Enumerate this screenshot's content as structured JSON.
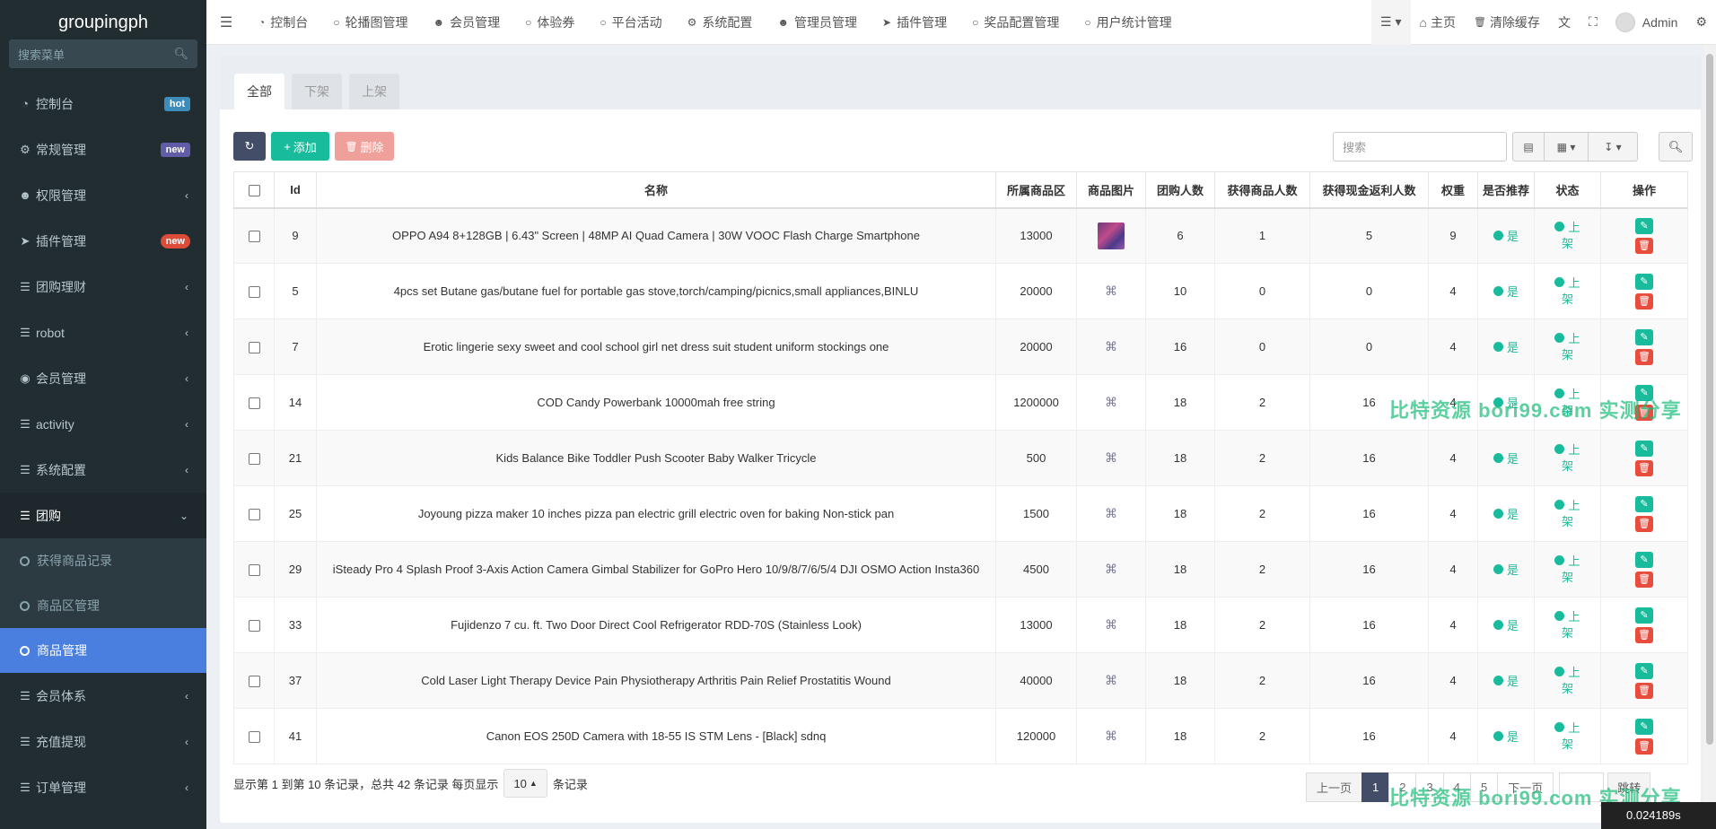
{
  "app": {
    "title": "groupingph"
  },
  "sidebar": {
    "search_placeholder": "搜索菜单",
    "items": [
      {
        "label": "控制台",
        "badge": "hot"
      },
      {
        "label": "常规管理",
        "badge": "new"
      },
      {
        "label": "权限管理"
      },
      {
        "label": "插件管理",
        "badge": "new"
      },
      {
        "label": "团购理财"
      },
      {
        "label": "robot"
      },
      {
        "label": "会员管理"
      },
      {
        "label": "activity"
      },
      {
        "label": "系统配置"
      },
      {
        "label": "团购"
      }
    ],
    "sub_items": [
      {
        "label": "获得商品记录"
      },
      {
        "label": "商品区管理"
      },
      {
        "label": "商品管理"
      }
    ],
    "items_after": [
      {
        "label": "会员体系"
      },
      {
        "label": "充值提现"
      },
      {
        "label": "订单管理"
      }
    ]
  },
  "topnav": {
    "items": [
      {
        "label": "控制台"
      },
      {
        "label": "轮播图管理"
      },
      {
        "label": "会员管理"
      },
      {
        "label": "体验券"
      },
      {
        "label": "平台活动"
      },
      {
        "label": "系统配置"
      },
      {
        "label": "管理员管理"
      },
      {
        "label": "插件管理"
      },
      {
        "label": "奖品配置管理"
      },
      {
        "label": "用户统计管理"
      }
    ],
    "home": "主页",
    "clear_cache": "清除缓存",
    "user": "Admin"
  },
  "tabs": [
    {
      "label": "全部"
    },
    {
      "label": "下架"
    },
    {
      "label": "上架"
    }
  ],
  "toolbar": {
    "add": "添加",
    "delete": "删除",
    "search_placeholder": "搜索"
  },
  "table": {
    "columns": [
      "Id",
      "名称",
      "所属商品区",
      "商品图片",
      "团购人数",
      "获得商品人数",
      "获得现金返利人数",
      "权重",
      "是否推荐",
      "状态",
      "操作"
    ],
    "recommend_text": "是",
    "status_text": "上架",
    "rows": [
      {
        "id": "9",
        "name": "OPPO A94 8+128GB | 6.43\" Screen | 48MP AI Quad Camera | 30W VOOC Flash Charge Smartphone",
        "zone": "13000",
        "group": "6",
        "win": "1",
        "cash": "5",
        "weight": "9"
      },
      {
        "id": "5",
        "name": "4pcs set Butane gas/butane fuel for portable gas stove,torch/camping/picnics,small appliances,BINLU",
        "zone": "20000",
        "group": "10",
        "win": "0",
        "cash": "0",
        "weight": "4"
      },
      {
        "id": "7",
        "name": "Erotic lingerie sexy sweet and cool school girl net dress suit student uniform stockings one",
        "zone": "20000",
        "group": "16",
        "win": "0",
        "cash": "0",
        "weight": "4"
      },
      {
        "id": "14",
        "name": "COD Candy Powerbank 10000mah free string",
        "zone": "1200000",
        "group": "18",
        "win": "2",
        "cash": "16",
        "weight": "4"
      },
      {
        "id": "21",
        "name": "Kids Balance Bike Toddler Push Scooter Baby Walker Tricycle",
        "zone": "500",
        "group": "18",
        "win": "2",
        "cash": "16",
        "weight": "4"
      },
      {
        "id": "25",
        "name": "Joyoung pizza maker 10 inches pizza pan electric grill electric oven for baking Non-stick pan",
        "zone": "1500",
        "group": "18",
        "win": "2",
        "cash": "16",
        "weight": "4"
      },
      {
        "id": "29",
        "name": "iSteady Pro 4 Splash Proof 3-Axis Action Camera Gimbal Stabilizer for GoPro Hero 10/9/8/7/6/5/4 DJI OSMO Action Insta360",
        "zone": "4500",
        "group": "18",
        "win": "2",
        "cash": "16",
        "weight": "4"
      },
      {
        "id": "33",
        "name": "Fujidenzo 7 cu. ft. Two Door Direct Cool Refrigerator RDD-70S (Stainless Look)",
        "zone": "13000",
        "group": "18",
        "win": "2",
        "cash": "16",
        "weight": "4"
      },
      {
        "id": "37",
        "name": "Cold Laser Light Therapy Device Pain Physiotherapy Arthritis Pain Relief Prostatitis Wound",
        "zone": "40000",
        "group": "18",
        "win": "2",
        "cash": "16",
        "weight": "4"
      },
      {
        "id": "41",
        "name": "Canon EOS 250D Camera with 18-55 IS STM Lens - [Black] sdnq",
        "zone": "120000",
        "group": "18",
        "win": "2",
        "cash": "16",
        "weight": "4"
      }
    ]
  },
  "footer": {
    "info_prefix": "显示第 1 到第 10 条记录，总共 42 条记录 每页显示",
    "per_page": "10",
    "info_suffix": "条记录",
    "prev": "上一页",
    "pages": [
      "1",
      "2",
      "3",
      "4",
      "5"
    ],
    "next": "下一页",
    "jump": "跳转"
  },
  "watermark": "比特资源  bori99.com  实测分享",
  "timer": "0.024189s"
}
